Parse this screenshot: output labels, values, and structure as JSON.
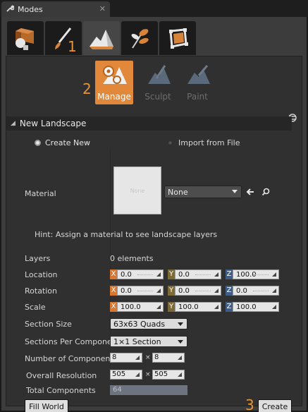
{
  "window": {
    "title": "Modes"
  },
  "annotations": {
    "a1": "1",
    "a2": "2",
    "a3": "3"
  },
  "tools": [
    {
      "label": "Manage",
      "active": true
    },
    {
      "label": "Sculpt",
      "active": false
    },
    {
      "label": "Paint",
      "active": false
    }
  ],
  "section": {
    "title": "New Landscape"
  },
  "radios": {
    "create_new": "Create New",
    "import_from_file": "Import from File"
  },
  "material": {
    "label": "Material",
    "thumb_text": "None",
    "combo_value": "None"
  },
  "hint": "Hint: Assign a material to see landscape layers",
  "layers": {
    "label": "Layers",
    "value": "0 elements"
  },
  "location": {
    "label": "Location",
    "x": "0.0",
    "y": "0.0",
    "z": "100.0"
  },
  "rotation": {
    "label": "Rotation",
    "x": "0.0",
    "y": "0.0",
    "z": "0.0"
  },
  "scale": {
    "label": "Scale",
    "x": "100.0",
    "y": "100.0",
    "z": "100.0"
  },
  "section_size": {
    "label": "Section Size",
    "value": "63x63 Quads"
  },
  "sections_per_component": {
    "label": "Sections Per Compone",
    "value": "1×1 Section"
  },
  "number_of_components": {
    "label": "Number of Component",
    "x": "8",
    "y": "8",
    "sep": "×"
  },
  "overall_resolution": {
    "label": "Overall Resolution",
    "x": "505",
    "y": "505",
    "sep": "×"
  },
  "total_components": {
    "label": "Total Components",
    "value": "64"
  },
  "buttons": {
    "fill_world": "Fill World",
    "create": "Create"
  },
  "colors": {
    "accent": "#e2883b",
    "x_axis": "#d97731",
    "y_axis": "#7e6a34",
    "z_axis": "#3f5d86"
  }
}
